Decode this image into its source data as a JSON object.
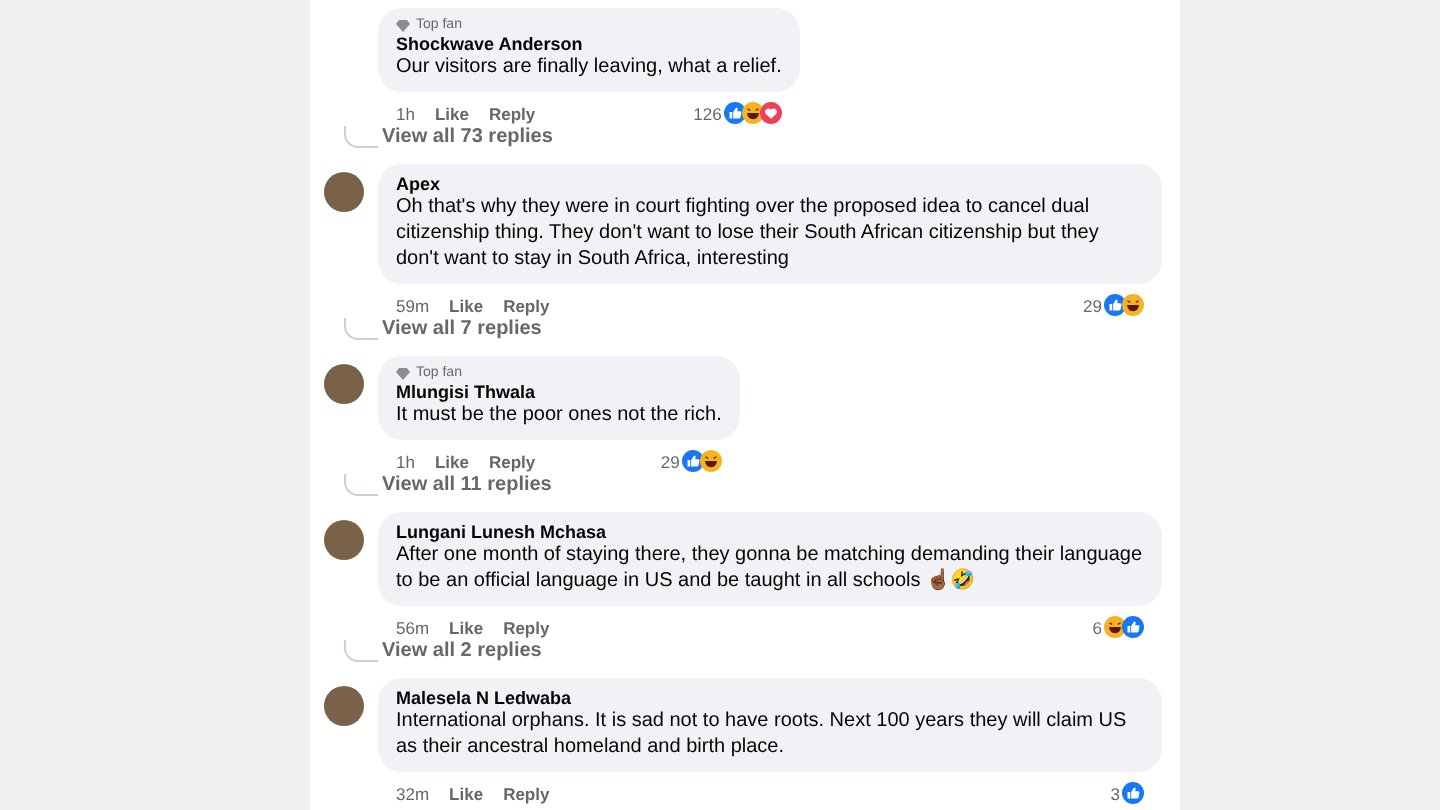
{
  "comments": [
    {
      "show_avatar": false,
      "badge": "Top fan",
      "author": "Shockwave Anderson",
      "text": "Our visitors are finally leaving, what a relief.",
      "time": "1h",
      "like": "Like",
      "reply": "Reply",
      "reaction_count": "126",
      "reactions": [
        {
          "kind": "like"
        },
        {
          "kind": "haha"
        },
        {
          "kind": "care"
        }
      ],
      "replies_link": "View all 73 replies"
    },
    {
      "show_avatar": true,
      "author": "Apex",
      "text": "Oh that's why they were in court fighting over the proposed idea to cancel dual citizenship thing. They don't want to lose their South African citizenship but they don't want to stay in South Africa, interesting",
      "time": "59m",
      "like": "Like",
      "reply": "Reply",
      "reaction_count": "29",
      "reactions": [
        {
          "kind": "like"
        },
        {
          "kind": "haha"
        }
      ],
      "replies_link": "View all 7 replies"
    },
    {
      "show_avatar": true,
      "badge": "Top fan",
      "author": "Mlungisi Thwala",
      "text": "It must be the poor ones not the rich.",
      "time": "1h",
      "like": "Like",
      "reply": "Reply",
      "reaction_count": "29",
      "reactions": [
        {
          "kind": "like"
        },
        {
          "kind": "haha"
        }
      ],
      "replies_link": "View all 11 replies"
    },
    {
      "show_avatar": true,
      "author": "Lungani Lunesh Mchasa",
      "text": "After one month of staying there, they gonna be matching demanding their language to be an official language in US and be taught in all schools ☝🏾🤣",
      "time": "56m",
      "like": "Like",
      "reply": "Reply",
      "reaction_count": "6",
      "reactions": [
        {
          "kind": "haha"
        },
        {
          "kind": "like"
        }
      ],
      "replies_link": "View all 2 replies"
    },
    {
      "show_avatar": true,
      "author": "Malesela N Ledwaba",
      "text": "International orphans. It is sad not to have roots. Next 100 years they will claim US as their ancestral homeland and birth place.",
      "time": "32m",
      "like": "Like",
      "reply": "Reply",
      "reaction_count": "3",
      "reactions": [
        {
          "kind": "like"
        }
      ]
    }
  ]
}
